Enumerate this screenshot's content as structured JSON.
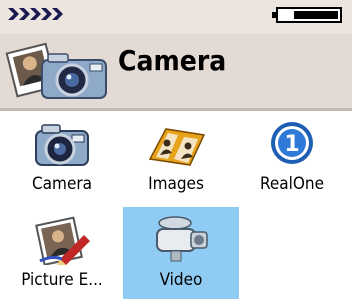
{
  "app": {
    "title": "Camera"
  },
  "status": {
    "signal_icon": "signal-arrows-icon",
    "battery_icon": "battery-icon"
  },
  "header": {
    "icon": "camera-photos-icon",
    "title": "Camera"
  },
  "apps": [
    {
      "label": "Camera",
      "icon": "camera-icon",
      "selected": false
    },
    {
      "label": "Images",
      "icon": "images-icon",
      "selected": false
    },
    {
      "label": "RealOne",
      "icon": "realone-icon",
      "selected": false
    },
    {
      "label": "Picture E...",
      "icon": "picture-editor-icon",
      "selected": false
    },
    {
      "label": "Video",
      "icon": "video-camera-icon",
      "selected": true
    }
  ],
  "colors": {
    "selection": "#8fcbf2",
    "header_bg": "#e4dad4",
    "status_bg": "#ece4de"
  }
}
